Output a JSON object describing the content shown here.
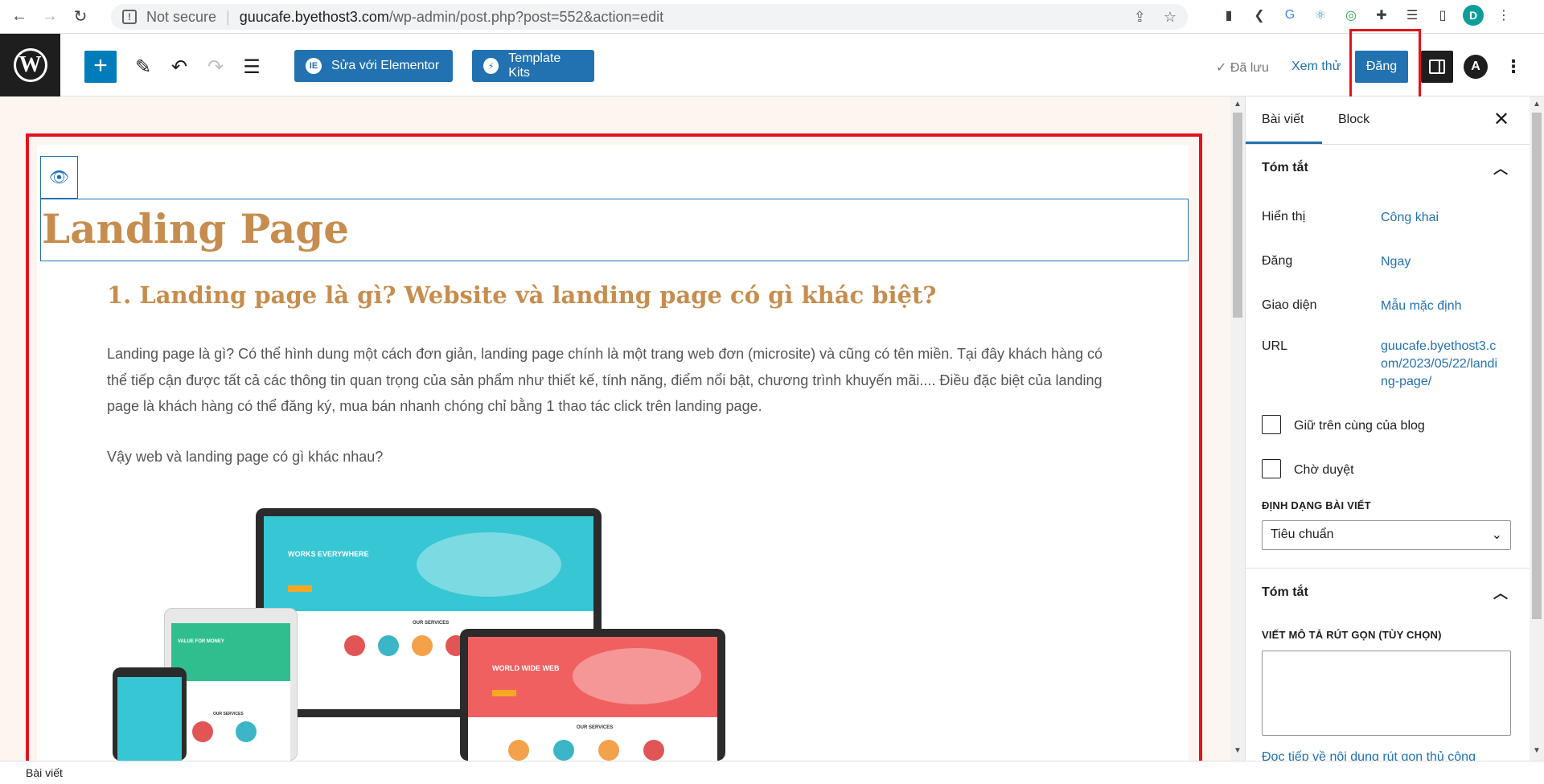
{
  "browser": {
    "security_text": "Not secure",
    "url_host": "guucafe.byethost3.com",
    "url_path": "/wp-admin/post.php?post=552&action=edit",
    "profile_initial": "D"
  },
  "toolbar": {
    "elementor_label": "Sửa với Elementor",
    "template_kits_label": "Template Kits",
    "saved_label": "✓ Đã lưu",
    "preview_label": "Xem thử",
    "publish_label": "Đăng"
  },
  "post": {
    "title": "Landing Page",
    "heading": "1. Landing page là gì? Website và landing page có gì khác biệt?",
    "paragraph_1": "Landing page là gì? Có thể hình dung một cách đơn giản, landing page chính là một trang web đơn (microsite) và cũng có tên miền. Tại đây khách hàng có thể tiếp cận được tất cả các thông tin quan trọng của sản phẩm như thiết kế, tính năng, điểm nổi bật, chương trình khuyến mãi.... Điều đặc biệt của landing page là khách hàng có thể đăng ký, mua bán nhanh chóng chỉ bằng 1 thao tác click trên landing page.",
    "paragraph_2": "Vậy web và landing page có gì khác nhau?",
    "illustration": {
      "laptop_headline": "WORKS EVERYWHERE",
      "tablet_headline": "VALUE FOR MONEY",
      "monitor_headline": "WORLD WIDE WEB",
      "section_label": "OUR SERVICES"
    }
  },
  "sidebar": {
    "tab_post": "Bài viết",
    "tab_block": "Block",
    "summary_title": "Tóm tắt",
    "visibility_label": "Hiển thị",
    "visibility_value": "Công khai",
    "publish_label": "Đăng",
    "publish_value": "Ngay",
    "template_label": "Giao diện",
    "template_value": "Mẫu mặc định",
    "url_label": "URL",
    "url_value": "guucafe.byethost3.com/2023/05/22/landing-page/",
    "sticky_label": "Giữ trên cùng của blog",
    "pending_label": "Chờ duyệt",
    "format_label": "ĐỊNH DẠNG BÀI VIẾT",
    "format_value": "Tiêu chuẩn",
    "excerpt_title": "Tóm tắt",
    "excerpt_label": "VIẾT MÔ TẢ RÚT GỌN (TÙY CHỌN)",
    "excerpt_value": "",
    "excerpt_more_link": "Đọc tiếp về nội dung rút gọn thủ công"
  },
  "footer": {
    "breadcrumb": "Bài viết"
  },
  "colors": {
    "accent": "#2271b1",
    "title": "#c68d4e",
    "highlight": "#e3131b",
    "canvas_bg": "#fdf6f0"
  }
}
